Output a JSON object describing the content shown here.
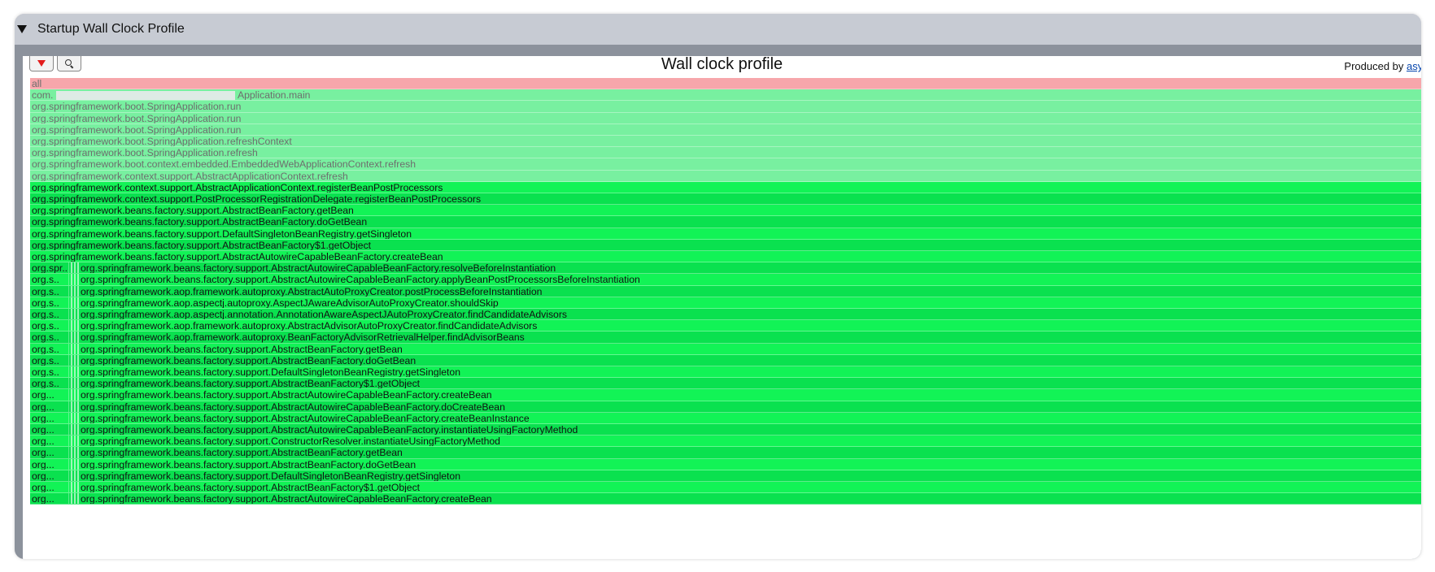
{
  "panel": {
    "title": "Startup Wall Clock Profile"
  },
  "profile": {
    "title": "Wall clock profile",
    "produced_by_prefix": "Produced by ",
    "produced_by_link": "async"
  },
  "colors": {
    "root": "#f7a6ab",
    "muted_green": "#78f0a0",
    "bright_green_a": "#0ae14f",
    "bright_green_b": "#12f356"
  },
  "icons": {
    "collapse": "triangle-down-icon",
    "reverse": "red-arrow-down-icon",
    "search": "magnifier-icon"
  },
  "frames": [
    {
      "label": "all",
      "kind": "root"
    },
    {
      "label": "com.",
      "suffix": "Application.main",
      "kind": "muted",
      "redacted": true
    },
    {
      "label": "org.springframework.boot.SpringApplication.run",
      "kind": "muted"
    },
    {
      "label": "org.springframework.boot.SpringApplication.run",
      "kind": "muted"
    },
    {
      "label": "org.springframework.boot.SpringApplication.run",
      "kind": "muted"
    },
    {
      "label": "org.springframework.boot.SpringApplication.refreshContext",
      "kind": "muted"
    },
    {
      "label": "org.springframework.boot.SpringApplication.refresh",
      "kind": "muted"
    },
    {
      "label": "org.springframework.boot.context.embedded.EmbeddedWebApplicationContext.refresh",
      "kind": "muted"
    },
    {
      "label": "org.springframework.context.support.AbstractApplicationContext.refresh",
      "kind": "muted"
    },
    {
      "label": "org.springframework.context.support.AbstractApplicationContext.registerBeanPostProcessors",
      "kind": "bright"
    },
    {
      "label": "org.springframework.context.support.PostProcessorRegistrationDelegate.registerBeanPostProcessors",
      "kind": "bright"
    },
    {
      "label": "org.springframework.beans.factory.support.AbstractBeanFactory.getBean",
      "kind": "bright"
    },
    {
      "label": "org.springframework.beans.factory.support.AbstractBeanFactory.doGetBean",
      "kind": "bright"
    },
    {
      "label": "org.springframework.beans.factory.support.DefaultSingletonBeanRegistry.getSingleton",
      "kind": "bright"
    },
    {
      "label": "org.springframework.beans.factory.support.AbstractBeanFactory$1.getObject",
      "kind": "bright"
    },
    {
      "label": "org.springframework.beans.factory.support.AbstractAutowireCapableBeanFactory.createBean",
      "kind": "bright"
    },
    {
      "short": "org.spr..",
      "label": "org.springframework.beans.factory.support.AbstractAutowireCapableBeanFactory.resolveBeforeInstantiation",
      "kind": "split"
    },
    {
      "short": "org.s..",
      "label": "org.springframework.beans.factory.support.AbstractAutowireCapableBeanFactory.applyBeanPostProcessorsBeforeInstantiation",
      "kind": "split"
    },
    {
      "short": "org.s..",
      "label": "org.springframework.aop.framework.autoproxy.AbstractAutoProxyCreator.postProcessBeforeInstantiation",
      "kind": "split"
    },
    {
      "short": "org.s..",
      "label": "org.springframework.aop.aspectj.autoproxy.AspectJAwareAdvisorAutoProxyCreator.shouldSkip",
      "kind": "split"
    },
    {
      "short": "org.s..",
      "label": "org.springframework.aop.aspectj.annotation.AnnotationAwareAspectJAutoProxyCreator.findCandidateAdvisors",
      "kind": "split"
    },
    {
      "short": "org.s..",
      "label": "org.springframework.aop.framework.autoproxy.AbstractAdvisorAutoProxyCreator.findCandidateAdvisors",
      "kind": "split"
    },
    {
      "short": "org.s..",
      "label": "org.springframework.aop.framework.autoproxy.BeanFactoryAdvisorRetrievalHelper.findAdvisorBeans",
      "kind": "split"
    },
    {
      "short": "org.s..",
      "label": "org.springframework.beans.factory.support.AbstractBeanFactory.getBean",
      "kind": "split"
    },
    {
      "short": "org.s..",
      "label": "org.springframework.beans.factory.support.AbstractBeanFactory.doGetBean",
      "kind": "split"
    },
    {
      "short": "org.s..",
      "label": "org.springframework.beans.factory.support.DefaultSingletonBeanRegistry.getSingleton",
      "kind": "split"
    },
    {
      "short": "org.s..",
      "label": "org.springframework.beans.factory.support.AbstractBeanFactory$1.getObject",
      "kind": "split"
    },
    {
      "short": "org...",
      "label": "org.springframework.beans.factory.support.AbstractAutowireCapableBeanFactory.createBean",
      "kind": "split"
    },
    {
      "short": "org...",
      "label": "org.springframework.beans.factory.support.AbstractAutowireCapableBeanFactory.doCreateBean",
      "kind": "split"
    },
    {
      "short": "org...",
      "label": "org.springframework.beans.factory.support.AbstractAutowireCapableBeanFactory.createBeanInstance",
      "kind": "split"
    },
    {
      "short": "org...",
      "label": "org.springframework.beans.factory.support.AbstractAutowireCapableBeanFactory.instantiateUsingFactoryMethod",
      "kind": "split"
    },
    {
      "short": "org...",
      "label": "org.springframework.beans.factory.support.ConstructorResolver.instantiateUsingFactoryMethod",
      "kind": "split"
    },
    {
      "short": "org...",
      "label": "org.springframework.beans.factory.support.AbstractBeanFactory.getBean",
      "kind": "split"
    },
    {
      "short": "org...",
      "label": "org.springframework.beans.factory.support.AbstractBeanFactory.doGetBean",
      "kind": "split"
    },
    {
      "short": "org...",
      "label": "org.springframework.beans.factory.support.DefaultSingletonBeanRegistry.getSingleton",
      "kind": "split"
    },
    {
      "short": "org...",
      "label": "org.springframework.beans.factory.support.AbstractBeanFactory$1.getObject",
      "kind": "split"
    },
    {
      "short": "org...",
      "label": "org.springframework.beans.factory.support.AbstractAutowireCapableBeanFactory.createBean",
      "kind": "split"
    }
  ]
}
